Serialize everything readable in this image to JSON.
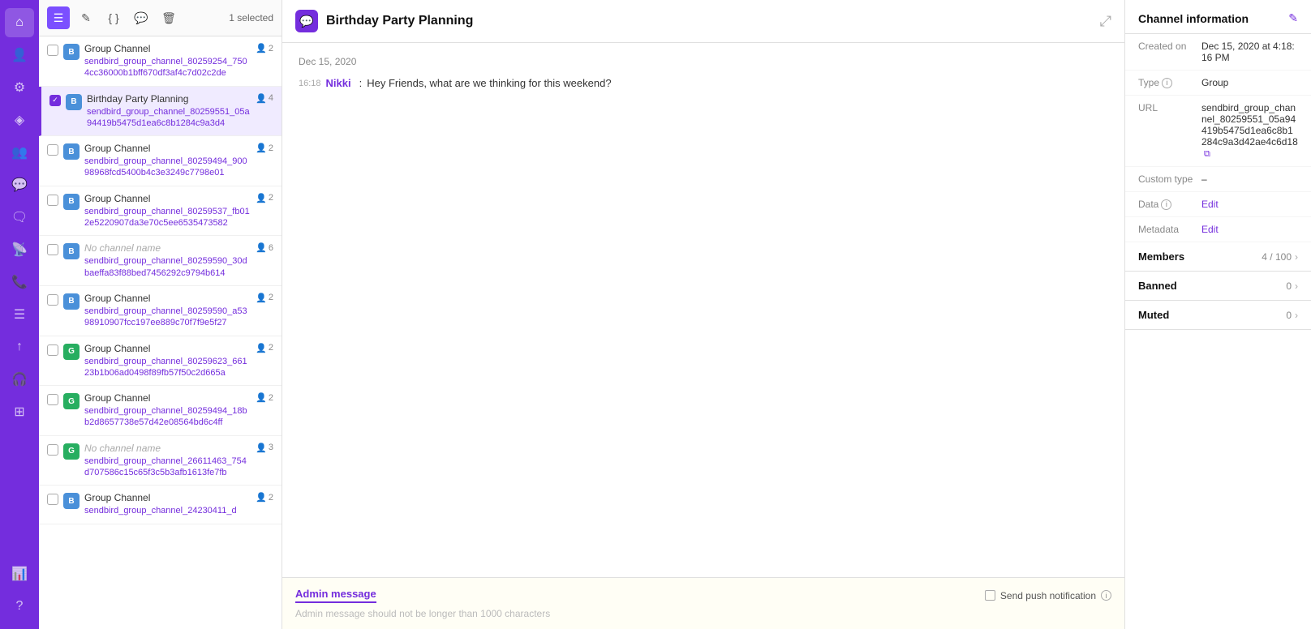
{
  "app": {
    "title": "Birthday Party Planning"
  },
  "toolbar": {
    "selected_count": "1 selected",
    "icons": [
      "hamburger",
      "edit",
      "code",
      "chat",
      "trash"
    ]
  },
  "channels": [
    {
      "id": 1,
      "name": "Group Channel",
      "url": "sendbird_group_channel_80259254_7504cc36000b1bff670df3af4c7d02c2de",
      "icon_color": "blue",
      "member_count": 2,
      "selected": false,
      "checked": false,
      "no_name": false
    },
    {
      "id": 2,
      "name": "Birthday Party Planning",
      "url": "sendbird_group_channel_80259551_05a94419b5475d1ea6c8b1284c9a3d4",
      "icon_color": "blue",
      "member_count": 4,
      "selected": true,
      "checked": true,
      "no_name": false
    },
    {
      "id": 3,
      "name": "Group Channel",
      "url": "sendbird_group_channel_80259494_90098968fcd5400b4c3e3249c7798e01",
      "icon_color": "blue",
      "member_count": 2,
      "selected": false,
      "checked": false,
      "no_name": false
    },
    {
      "id": 4,
      "name": "Group Channel",
      "url": "sendbird_group_channel_80259537_fb012e5220907da3e70c5ee6535473582",
      "icon_color": "blue",
      "member_count": 2,
      "selected": false,
      "checked": false,
      "no_name": false
    },
    {
      "id": 5,
      "name": "No channel name",
      "url": "sendbird_group_channel_80259590_30dbaeffa83f88bed7456292c9794b614",
      "icon_color": "blue",
      "member_count": 6,
      "selected": false,
      "checked": false,
      "no_name": true
    },
    {
      "id": 6,
      "name": "Group Channel",
      "url": "sendbird_group_channel_80259590_a5398910907fcc197ee889c70f7f9e5f27",
      "icon_color": "blue",
      "member_count": 2,
      "selected": false,
      "checked": false,
      "no_name": false
    },
    {
      "id": 7,
      "name": "Group Channel",
      "url": "sendbird_group_channel_80259623_66123b1b06ad0498f89fb57f50c2d665a",
      "icon_color": "green",
      "member_count": 2,
      "selected": false,
      "checked": false,
      "no_name": false
    },
    {
      "id": 8,
      "name": "Group Channel",
      "url": "sendbird_group_channel_80259494_18bb2d8657738e57d42e08564bd6c4ff",
      "icon_color": "green",
      "member_count": 2,
      "selected": false,
      "checked": false,
      "no_name": false
    },
    {
      "id": 9,
      "name": "No channel name",
      "url": "sendbird_group_channel_26611463_754d707586c15c65f3c5b3afb1613fe7fb",
      "icon_color": "green",
      "member_count": 3,
      "selected": false,
      "checked": false,
      "no_name": true
    },
    {
      "id": 10,
      "name": "Group Channel",
      "url": "sendbird_group_channel_24230411_d",
      "icon_color": "blue",
      "member_count": 2,
      "selected": false,
      "checked": false,
      "no_name": false
    }
  ],
  "chat": {
    "date": "Dec 15, 2020",
    "messages": [
      {
        "time": "16:18",
        "sender": "Nikki",
        "text": "Hey Friends, what are we thinking for this weekend?"
      }
    ]
  },
  "admin_message": {
    "label": "Admin message",
    "placeholder": "Admin message should not be longer than 1000 characters",
    "send_push_label": "Send push notification"
  },
  "channel_info": {
    "title": "Channel information",
    "created_on_label": "Created on",
    "created_on_value": "Dec 15, 2020 at 4:18:16 PM",
    "type_label": "Type",
    "type_value": "Group",
    "url_label": "URL",
    "url_value": "sendbird_group_channel_80259551_05a94419b5475d1ea6c8b1284c9a3d42ae4c6d18",
    "custom_type_label": "Custom type",
    "custom_type_value": "–",
    "data_label": "Data",
    "data_edit": "Edit",
    "metadata_label": "Metadata",
    "metadata_edit": "Edit",
    "members_label": "Members",
    "members_count": "4 / 100",
    "banned_label": "Banned",
    "banned_count": "0",
    "muted_label": "Muted",
    "muted_count": "0"
  },
  "nav": {
    "icons": [
      "home",
      "users",
      "settings",
      "activity",
      "person",
      "message",
      "chat2",
      "arrow-up",
      "phone",
      "list",
      "broadcast",
      "upload",
      "headphone",
      "puzzle",
      "chart",
      "help"
    ]
  }
}
